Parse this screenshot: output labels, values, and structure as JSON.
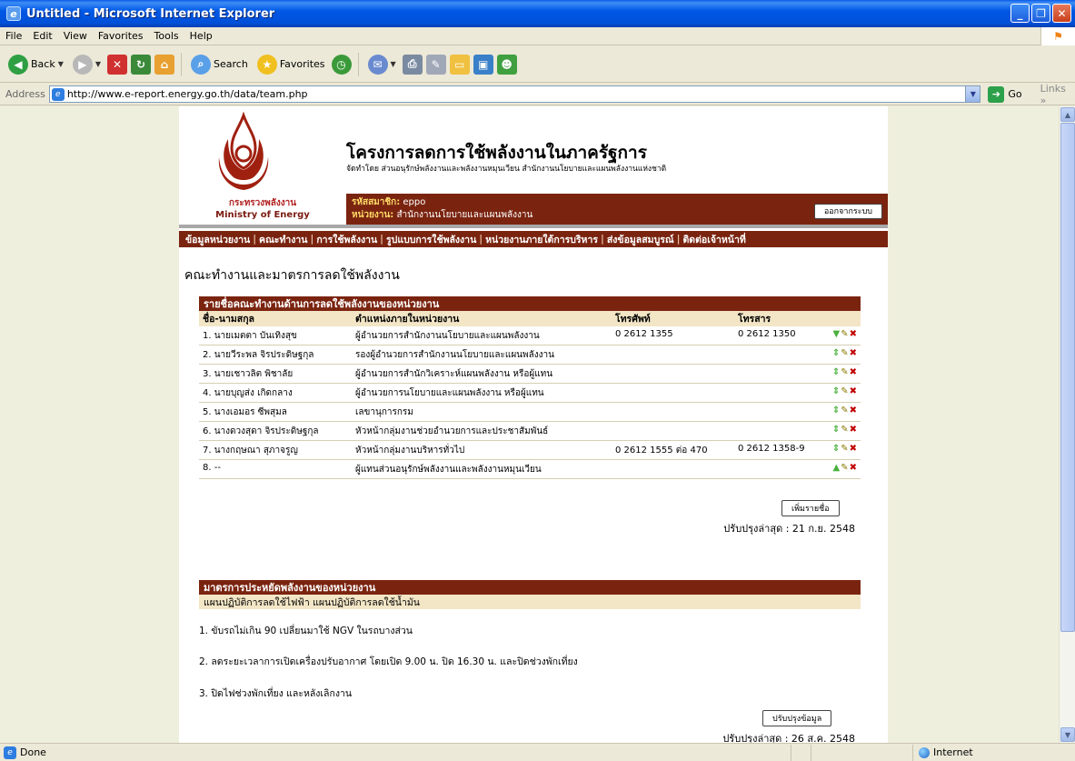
{
  "window": {
    "title": "Untitled - Microsoft Internet Explorer",
    "menu": [
      "File",
      "Edit",
      "View",
      "Favorites",
      "Tools",
      "Help"
    ]
  },
  "toolbar": {
    "back_label": "Back",
    "search_label": "Search",
    "favorites_label": "Favorites"
  },
  "address": {
    "label": "Address",
    "url": "http://www.e-report.energy.go.th/data/team.php",
    "go_label": "Go",
    "links_label": "Links"
  },
  "site": {
    "title": "โครงการลดการใช้พลังงานในภาครัฐการ",
    "subtitle": "จัดทำโดย ส่วนอนุรักษ์พลังงานและพลังงานหมุนเวียน สำนักงานนโยบายและแผนพลังงานแห่งชาติ",
    "ministry_th": "กระทรวงพลังงาน",
    "ministry_en": "Ministry of Energy",
    "member_label": "รหัสสมาชิก:",
    "member_value": "eppo",
    "agency_label": "หน่วยงาน:",
    "agency_value": "สำนักงานนโยบายและแผนพลังงาน",
    "logout_label": "ออกจากระบบ"
  },
  "nav": [
    "ข้อมูลหน่วยงาน",
    "คณะทำงาน",
    "การใช้พลังงาน",
    "รูปแบบการใช้พลังงาน",
    "หน่วยงานภายใต้การบริหาร",
    "ส่งข้อมูลสมบูรณ์",
    "ติดต่อเจ้าหน้าที่"
  ],
  "page_heading": "คณะทำงานและมาตรการลดใช้พลังงาน",
  "team": {
    "box_title": "รายชื่อคณะทำงานด้านการลดใช้พลังงานของหน่วยงาน",
    "columns": [
      "ชื่อ-นามสกุล",
      "ตำแหน่งภายในหน่วยงาน",
      "โทรศัพท์",
      "โทรสาร"
    ],
    "rows": [
      {
        "name": "1. นายเมตตา บันเทิงสุข",
        "position": "ผู้อำนวยการสำนักงานนโยบายและแผนพลังงาน",
        "tel": "0 2612 1355",
        "fax": "0 2612 1350",
        "sort": "down"
      },
      {
        "name": "2. นายวีระพล จิรประดิษฐกุล",
        "position": "รองผู้อำนวยการสำนักงานนโยบายและแผนพลังงาน",
        "tel": "",
        "fax": "",
        "sort": "both"
      },
      {
        "name": "3. นายเชาวลิต พิชาลัย",
        "position": "ผู้อำนวยการสำนักวิเคราะห์แผนพลังงาน หรือผู้แทน",
        "tel": "",
        "fax": "",
        "sort": "both"
      },
      {
        "name": "4. นายบุญส่ง เกิดกลาง",
        "position": "ผู้อำนวยการนโยบายและแผนพลังงาน หรือผู้แทน",
        "tel": "",
        "fax": "",
        "sort": "both"
      },
      {
        "name": "5. นางเอมอร ซีพสุมล",
        "position": "เลขานุการกรม",
        "tel": "",
        "fax": "",
        "sort": "both"
      },
      {
        "name": "6. นางดวงสุดา จิรประดิษฐกุล",
        "position": "หัวหน้ากลุ่มงานช่วยอำนวยการและประชาสัมพันธ์",
        "tel": "",
        "fax": "",
        "sort": "both"
      },
      {
        "name": "7. นางกฤษณา สุภาจรูญ",
        "position": "หัวหน้ากลุ่มงานบริหารทั่วไป",
        "tel": "0 2612 1555 ต่อ 470",
        "fax": "0 2612 1358-9",
        "sort": "both"
      },
      {
        "name": "8. --",
        "position": "ผู้แทนส่วนอนุรักษ์พลังงานและพลังงานหมุนเวียน",
        "tel": "",
        "fax": "",
        "sort": "up"
      }
    ],
    "add_button": "เพิ่มรายชื่อ",
    "updated": "ปรับปรุงล่าสุด : 21 ก.ย. 2548"
  },
  "measures": {
    "box_title": "มาตรการประหยัดพลังงานของหน่วยงาน",
    "sub_links": "แผนปฏิบัติการลดใช้ไฟฟ้า แผนปฏิบัติการลดใช้น้ำมัน",
    "items": [
      "1. ขับรถไม่เกิน 90 เปลี่ยนมาใช้ NGV ในรถบางส่วน",
      "2. ลดระยะเวลาการเปิดเครื่องปรับอากาศ โดยเปิด 9.00 น. ปิด 16.30 น. และปิดช่วงพักเที่ยง",
      "3. ปิดไฟช่วงพักเที่ยง และหลังเลิกงาน"
    ],
    "update_button": "ปรับปรุงข้อมูล",
    "updated": "ปรับปรุงล่าสุด : 26 ส.ค. 2548"
  },
  "status": {
    "text": "Done",
    "zone": "Internet"
  }
}
